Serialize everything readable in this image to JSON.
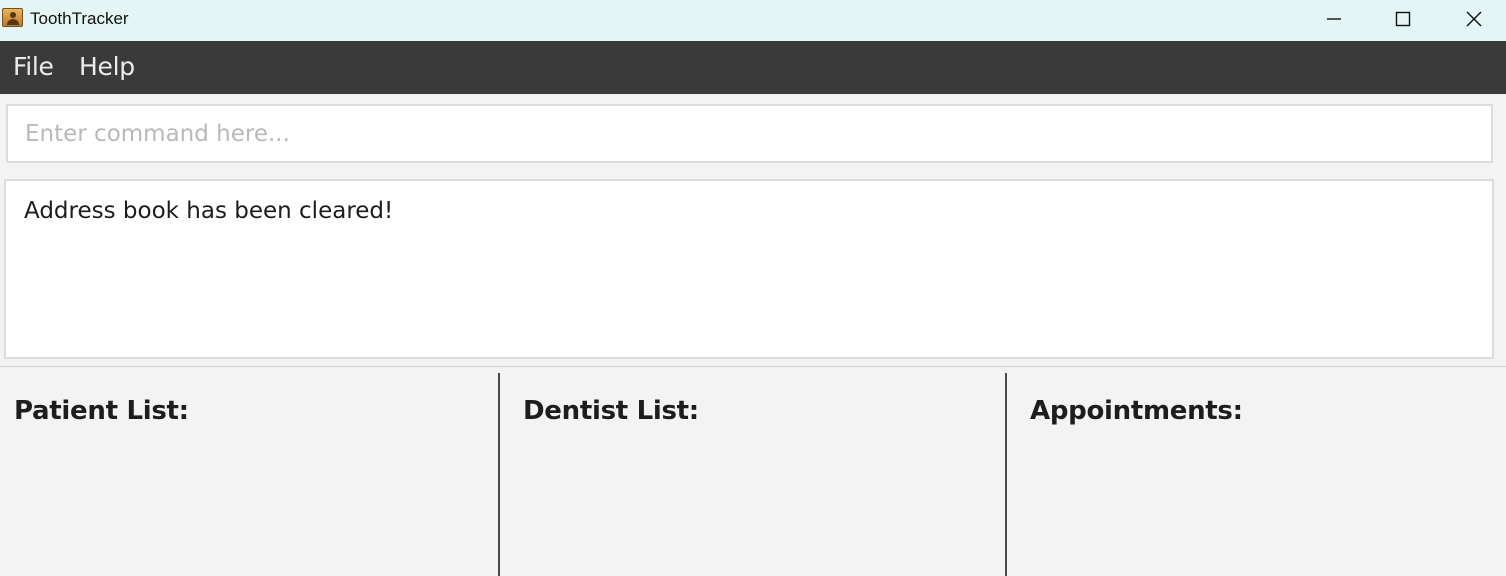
{
  "window": {
    "title": "ToothTracker",
    "icon": "address-book-icon",
    "controls": {
      "minimize": "minimize-icon",
      "maximize": "maximize-icon",
      "close": "close-icon"
    }
  },
  "menubar": {
    "items": [
      {
        "label": "File"
      },
      {
        "label": "Help"
      }
    ]
  },
  "command": {
    "value": "",
    "placeholder": "Enter command here..."
  },
  "result": {
    "text": "Address book has been cleared!"
  },
  "panels": [
    {
      "title": "Patient List:",
      "items": []
    },
    {
      "title": "Dentist List:",
      "items": []
    },
    {
      "title": "Appointments:",
      "items": []
    }
  ],
  "colors": {
    "titlebar": "#e4f5f6",
    "menubar": "#3a3a3a",
    "background": "#f3f3f3"
  }
}
